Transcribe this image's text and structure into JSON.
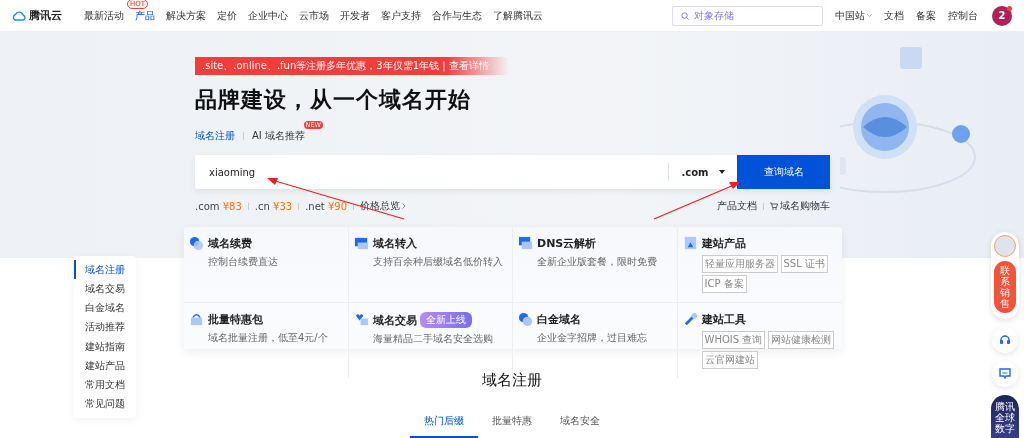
{
  "header": {
    "logo": "腾讯云",
    "nav": [
      {
        "label": "最新活动",
        "selected": false
      },
      {
        "label": "产品",
        "selected": true,
        "badge": "HOT"
      },
      {
        "label": "解决方案",
        "selected": false
      },
      {
        "label": "定价",
        "selected": false
      },
      {
        "label": "企业中心",
        "selected": false
      },
      {
        "label": "云市场",
        "selected": false
      },
      {
        "label": "开发者",
        "selected": false
      },
      {
        "label": "客户支持",
        "selected": false
      },
      {
        "label": "合作与生态",
        "selected": false
      },
      {
        "label": "了解腾讯云",
        "selected": false
      }
    ],
    "search": {
      "placeholder": "对象存储"
    },
    "links": [
      {
        "label": "中国站",
        "dropdown": true
      },
      {
        "label": "文档",
        "dropdown": false
      },
      {
        "label": "备案",
        "dropdown": false
      },
      {
        "label": "控制台",
        "dropdown": false
      }
    ],
    "avatar": "2",
    "notification_dot": true
  },
  "hero": {
    "promo": ".site、.online、.fun等注册多年优惠，3年仅需1年钱 | 查看详情",
    "title": "品牌建设，从一个域名开始",
    "tabs": [
      {
        "label": "域名注册",
        "selected": true
      },
      {
        "label": "AI 域名推荐",
        "selected": false,
        "badge": "NEW"
      }
    ],
    "domain_input": {
      "value": "xiaoming"
    },
    "suffix": ".com",
    "search_button": "查询域名",
    "prices": [
      {
        "suffix": ".com",
        "price": "¥83"
      },
      {
        "suffix": ".cn",
        "price": "¥33"
      },
      {
        "suffix": ".net",
        "price": "¥90"
      }
    ],
    "price_overview": "价格总览",
    "links": [
      {
        "label": "产品文档",
        "kind": "plain"
      },
      {
        "label": "域名购物车",
        "kind": "cart"
      }
    ]
  },
  "cards": [
    {
      "kind": "renew",
      "title": "域名续费",
      "desc": "控制台续费直达"
    },
    {
      "kind": "transfer",
      "title": "域名转入",
      "desc": "支持百余种后缀域名低价转入"
    },
    {
      "kind": "dns",
      "title": "DNS云解析",
      "desc": "全新企业版套餐，限时免费"
    },
    {
      "kind": "site",
      "title": "建站产品",
      "tags": [
        "轻量应用服务器",
        "SSL 证书",
        "ICP 备案"
      ]
    },
    {
      "kind": "bundle",
      "title": "批量特惠包",
      "desc": "域名批量注册，低至4元/个"
    },
    {
      "kind": "trade",
      "title": "域名交易",
      "badge": "全新上线",
      "desc": "海量精品二手域名安全选购"
    },
    {
      "kind": "platinum",
      "title": "白金域名",
      "desc": "企业金字招牌，过目难忘"
    },
    {
      "kind": "tools",
      "title": "建站工具",
      "tags": [
        "WHOIS 查询",
        "网站健康检测",
        "云官网建站"
      ]
    }
  ],
  "side_nav": [
    {
      "label": "域名注册",
      "selected": true
    },
    {
      "label": "域名交易",
      "selected": false
    },
    {
      "label": "白金域名",
      "selected": false
    },
    {
      "label": "活动推荐",
      "selected": false
    },
    {
      "label": "建站指南",
      "selected": false
    },
    {
      "label": "建站产品",
      "selected": false
    },
    {
      "label": "常用文档",
      "selected": false
    },
    {
      "label": "常见问题",
      "selected": false
    }
  ],
  "section": {
    "title": "域名注册",
    "tabs": [
      {
        "label": "热门后缀",
        "selected": true
      },
      {
        "label": "批量特惠",
        "selected": false
      },
      {
        "label": "域名安全",
        "selected": false
      }
    ]
  },
  "float_bar": {
    "sales": "联系销售",
    "banner": "腾讯全球数字"
  }
}
